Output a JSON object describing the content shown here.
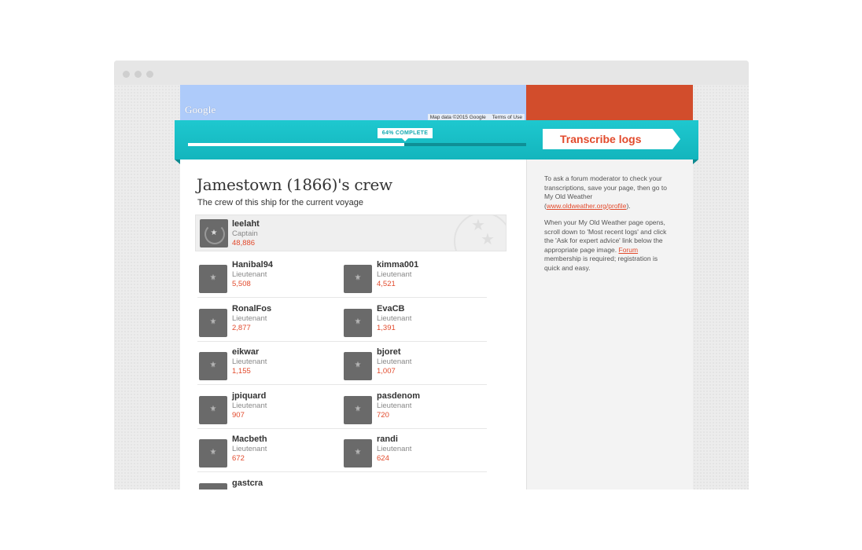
{
  "map": {
    "logo_text": "Google",
    "attribution": "Map data ©2015 Google",
    "terms": "Terms of Use"
  },
  "progress": {
    "label": "64% COMPLETE",
    "fraction": 0.64
  },
  "actions": {
    "transcribe_label": "Transcribe logs"
  },
  "page": {
    "title": "Jamestown (1866)'s crew",
    "subtitle": "The crew of this ship for the current voyage"
  },
  "captain": {
    "name": "leelaht",
    "rank": "Captain",
    "score": "48,886"
  },
  "crew": [
    {
      "name": "Hanibal94",
      "rank": "Lieutenant",
      "score": "5,508"
    },
    {
      "name": "kimma001",
      "rank": "Lieutenant",
      "score": "4,521"
    },
    {
      "name": "RonalFos",
      "rank": "Lieutenant",
      "score": "2,877"
    },
    {
      "name": "EvaCB",
      "rank": "Lieutenant",
      "score": "1,391"
    },
    {
      "name": "eikwar",
      "rank": "Lieutenant",
      "score": "1,155"
    },
    {
      "name": "bjoret",
      "rank": "Lieutenant",
      "score": "1,007"
    },
    {
      "name": "jpiquard",
      "rank": "Lieutenant",
      "score": "907"
    },
    {
      "name": "pasdenom",
      "rank": "Lieutenant",
      "score": "720"
    },
    {
      "name": "Macbeth",
      "rank": "Lieutenant",
      "score": "672"
    },
    {
      "name": "randi",
      "rank": "Lieutenant",
      "score": "624"
    },
    {
      "name": "gastcra",
      "rank": "",
      "score": ""
    }
  ],
  "sidebar": {
    "para1_before": "To ask a forum moderator to check your transcriptions, save your page, then go to My Old Weather (",
    "profile_link": "www.oldweather.org/profile",
    "para1_after": ").",
    "para2_before": "When your My Old Weather page opens, scroll down to 'Most recent logs' and click the 'Ask for expert advice' link below the appropriate page image. ",
    "forum_link": "Forum",
    "para2_after": " membership is required; registration is quick and easy."
  },
  "colors": {
    "teal": "#1ec8cf",
    "accent_red": "#e24a2c",
    "map_blue": "#aecbfa"
  }
}
